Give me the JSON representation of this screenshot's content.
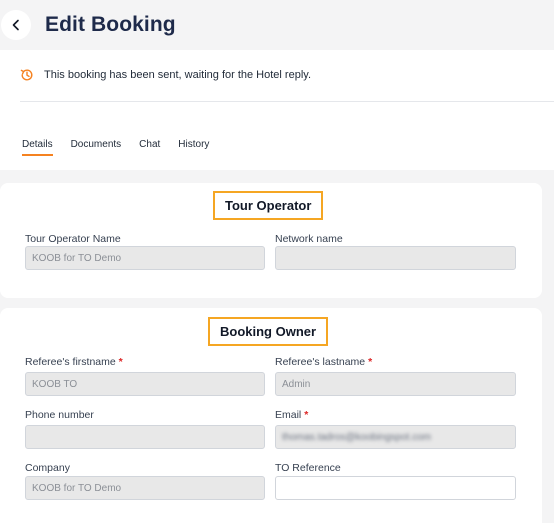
{
  "header": {
    "title": "Edit Booking"
  },
  "status": {
    "message": "This booking has been sent, waiting for the Hotel reply."
  },
  "tabs": [
    {
      "label": "Details",
      "active": true
    },
    {
      "label": "Documents",
      "active": false
    },
    {
      "label": "Chat",
      "active": false
    },
    {
      "label": "History",
      "active": false
    }
  ],
  "tour_operator": {
    "title": "Tour Operator",
    "name_label": "Tour Operator Name",
    "name_value": "KOOB for TO Demo",
    "network_label": "Network name",
    "network_value": ""
  },
  "booking_owner": {
    "title": "Booking Owner",
    "firstname_label": "Referee's firstname",
    "firstname_value": "KOOB TO",
    "lastname_label": "Referee's lastname",
    "lastname_value": "Admin",
    "phone_label": "Phone number",
    "phone_value": "",
    "email_label": "Email",
    "email_value": "thomas.tadros@koobingspot.com",
    "company_label": "Company",
    "company_value": "KOOB for TO Demo",
    "reference_label": "TO Reference",
    "reference_value": "",
    "required_mark": "*"
  },
  "colors": {
    "accent": "#f58220",
    "highlight_border": "#f5a623",
    "title": "#1e2a4a",
    "required": "#dc2626"
  },
  "icons": {
    "back": "chevron-left-icon",
    "status": "history-icon"
  }
}
